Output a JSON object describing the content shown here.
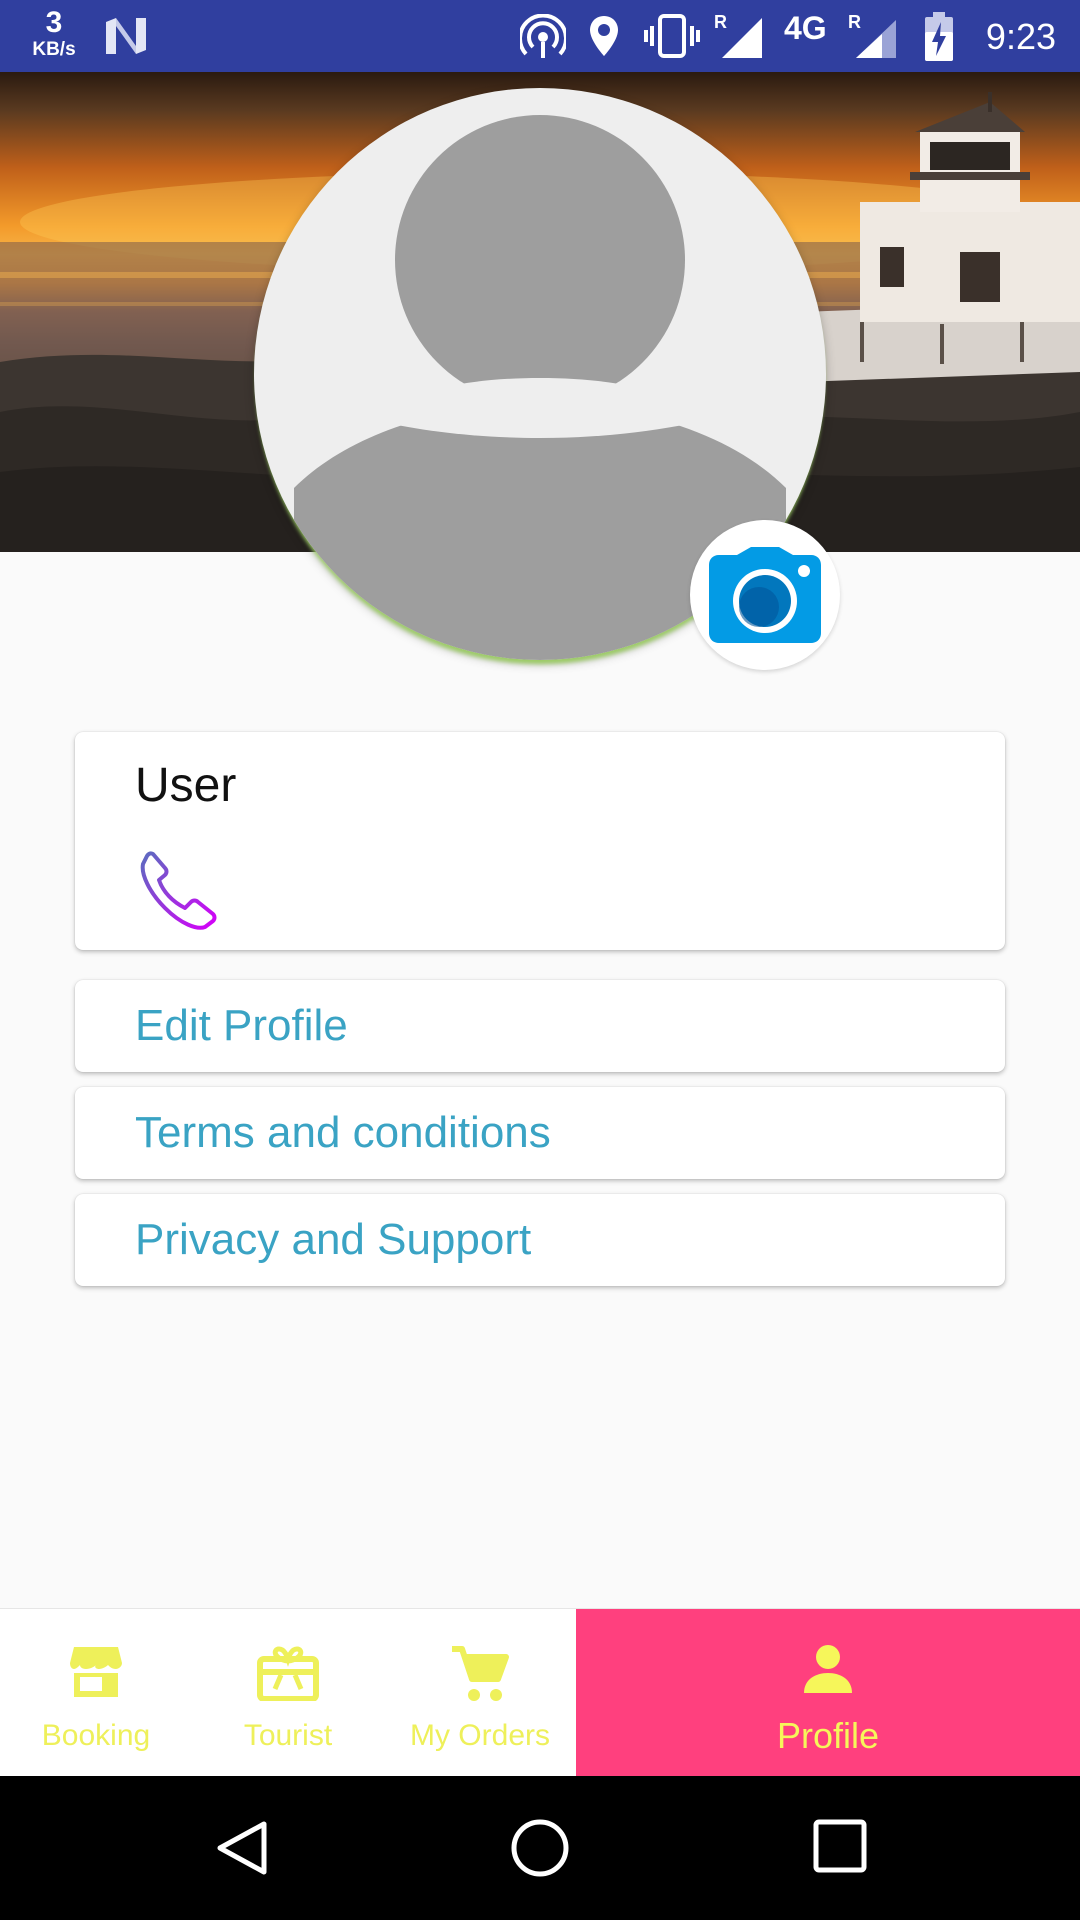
{
  "status_bar": {
    "net_speed_value": "3",
    "net_speed_unit": "KB/s",
    "network_type": "4G",
    "roaming_label_1": "R",
    "roaming_label_2": "R",
    "time": "9:23",
    "icons": [
      "n-icon",
      "hotspot-icon",
      "location-icon",
      "vibrate-icon",
      "signal-icon",
      "signal-icon",
      "battery-charging-icon"
    ]
  },
  "profile": {
    "user_name": "User",
    "avatar_icon": "person-placeholder-icon",
    "camera_icon": "camera-icon",
    "phone_icon": "phone-icon"
  },
  "menu": {
    "edit_profile": "Edit Profile",
    "terms": "Terms and conditions",
    "privacy": "Privacy and Support"
  },
  "bottom_nav": {
    "items": [
      {
        "label": "Booking",
        "icon": "store-icon"
      },
      {
        "label": "Tourist",
        "icon": "gift-card-icon"
      },
      {
        "label": "My Orders",
        "icon": "cart-icon"
      },
      {
        "label": "Profile",
        "icon": "person-icon",
        "selected": true
      }
    ]
  },
  "colors": {
    "status_bar": "#303f9f",
    "link_text": "#3aa3c4",
    "nav_selected_bg": "#ff407e",
    "nav_label": "#eef05a",
    "camera_blue": "#039be5"
  }
}
